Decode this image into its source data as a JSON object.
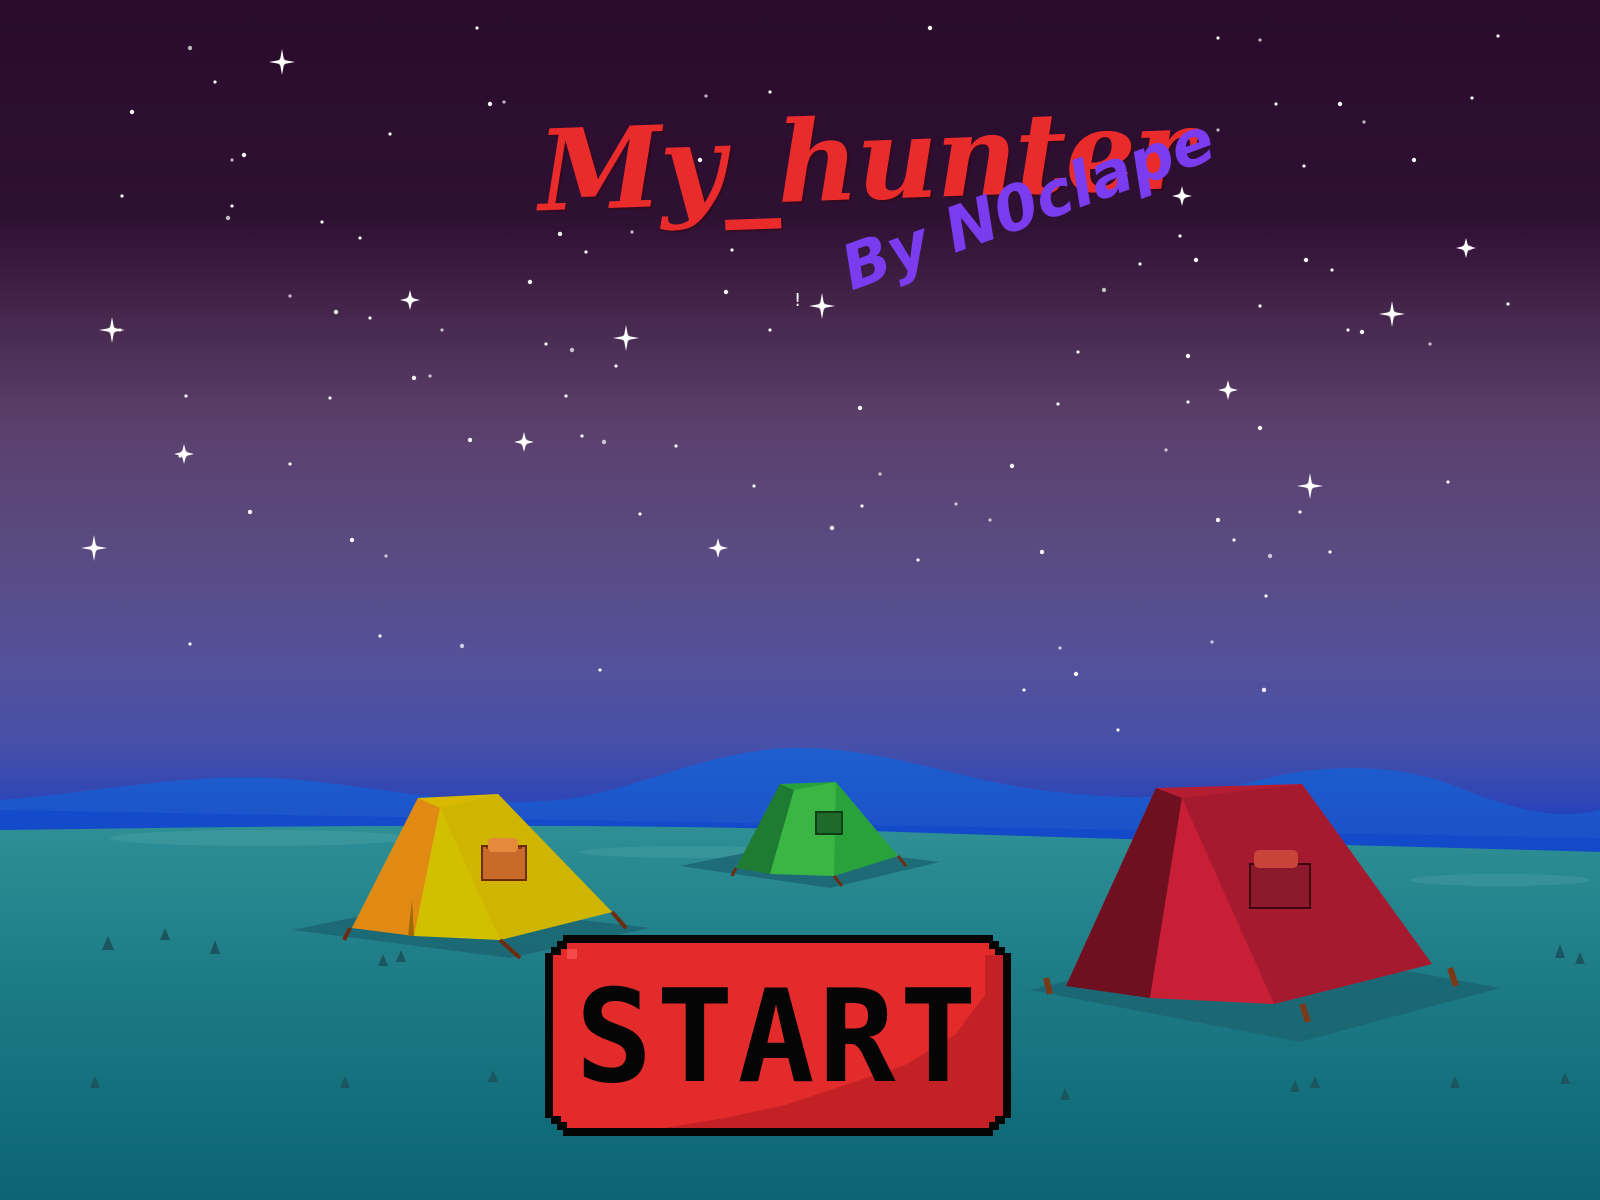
{
  "game": {
    "title": "My_hunter",
    "subtitle": "By N0clape",
    "mark": "!",
    "start_label": "START"
  },
  "colors": {
    "title": "#ea2b2b",
    "subtitle": "#7b3cf0",
    "button_face": "#e32b2b",
    "button_outline": "#050505",
    "ground": "#0f6f7d"
  },
  "scene": {
    "icons": [
      "star-icon",
      "yellow-tent-icon",
      "green-tent-icon",
      "red-tent-icon"
    ]
  }
}
